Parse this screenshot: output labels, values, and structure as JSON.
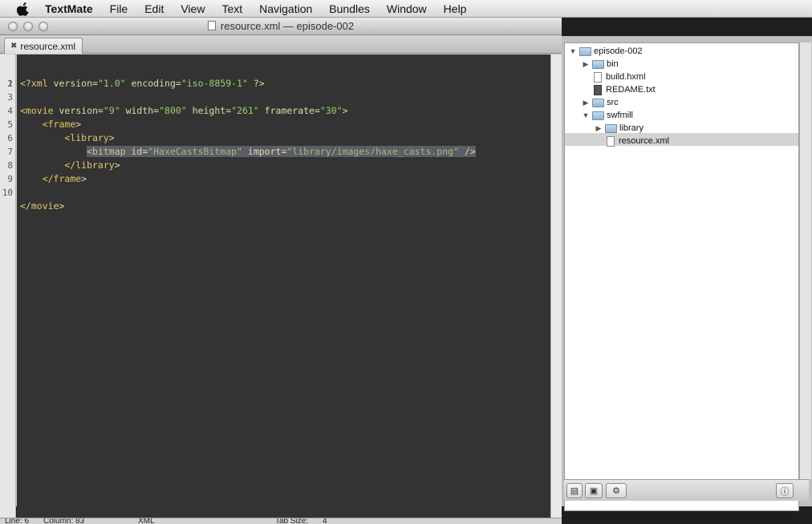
{
  "menubar": {
    "app": "TextMate",
    "items": [
      "File",
      "Edit",
      "View",
      "Text",
      "Navigation",
      "Bundles",
      "Window",
      "Help"
    ]
  },
  "window": {
    "title": "resource.xml — episode-002",
    "tab": "resource.xml"
  },
  "gutter": [
    "1",
    "2",
    "3",
    "4",
    "5",
    "6",
    "7",
    "8",
    "9",
    "10"
  ],
  "editor": {
    "lines": [
      "<?xml version=\"1.0\" encoding=\"iso-8859-1\" ?>",
      "",
      "<movie version=\"9\" width=\"800\" height=\"261\" framerate=\"30\">",
      "    <frame>",
      "        <library>",
      "            <bitmap id=\"HaxeCastsBitmap\" import=\"library/images/haxe_casts.png\" />",
      "        </library>",
      "    </frame>",
      "",
      "</movie>"
    ]
  },
  "status": {
    "line": "Line: 6",
    "column": "Column: 83",
    "language": "XML",
    "tab_size": "Tab Size:",
    "tab_value": "4"
  },
  "project": {
    "root": "episode-002",
    "items": [
      {
        "name": "bin",
        "kind": "folder"
      },
      {
        "name": "build.hxml",
        "kind": "file"
      },
      {
        "name": "REDAME.txt",
        "kind": "file"
      },
      {
        "name": "src",
        "kind": "folder"
      },
      {
        "name": "swfmill",
        "kind": "folder"
      },
      {
        "name": "library",
        "kind": "folder"
      },
      {
        "name": "resource.xml",
        "kind": "file"
      }
    ]
  }
}
